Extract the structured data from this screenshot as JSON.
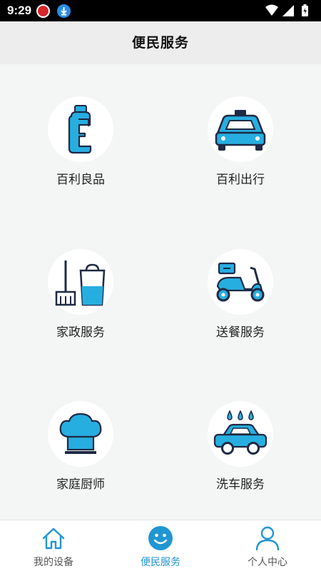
{
  "status_bar": {
    "time": "9:29"
  },
  "header": {
    "title": "便民服务"
  },
  "services": [
    {
      "label": "百利良品",
      "icon": "bottle-icon"
    },
    {
      "label": "百利出行",
      "icon": "taxi-icon"
    },
    {
      "label": "家政服务",
      "icon": "broom-bucket-icon"
    },
    {
      "label": "送餐服务",
      "icon": "scooter-icon"
    },
    {
      "label": "家庭厨师",
      "icon": "chef-hat-icon"
    },
    {
      "label": "洗车服务",
      "icon": "car-wash-icon"
    }
  ],
  "tabs": [
    {
      "label": "我的设备",
      "icon": "home-icon",
      "active": false
    },
    {
      "label": "便民服务",
      "icon": "smiley-icon",
      "active": true
    },
    {
      "label": "个人中心",
      "icon": "person-icon",
      "active": false
    }
  ],
  "colors": {
    "accent": "#2096d3",
    "icon_blue": "#27aee0",
    "icon_dark": "#1f2a44"
  }
}
